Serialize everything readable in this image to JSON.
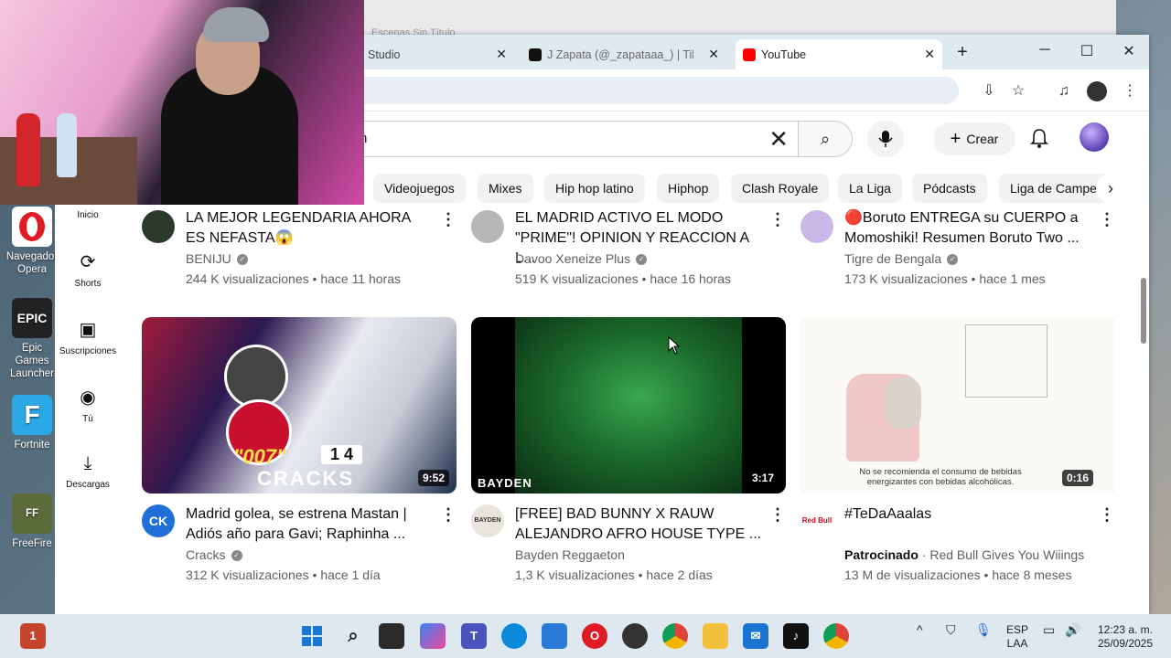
{
  "desktop": {
    "icons": [
      {
        "label": "Navegador Opera",
        "icon": "opera-icon",
        "color": "#e11b26"
      },
      {
        "label": "Epic Games Launcher",
        "icon": "epic-games-icon",
        "color": "#222222"
      },
      {
        "label": "Fortnite",
        "icon": "fortnite-icon",
        "color": "#2aa9e6"
      },
      {
        "label": "FreeFire",
        "icon": "freefire-icon",
        "color": "#5c6b3a"
      }
    ],
    "back_window_title": "Escenas Sin Título"
  },
  "browser": {
    "tabs": [
      {
        "label": "Studio"
      },
      {
        "label": "J Zapata (@_zapataaa_) | TikTok"
      },
      {
        "label": "YouTube",
        "active": true
      }
    ],
    "window_controls": {
      "minimize": "─",
      "maximize": "☐",
      "close": "✕"
    },
    "new_tab": "+"
  },
  "youtube": {
    "search_value": "h",
    "create_label": "Crear",
    "chips": [
      "Videojuegos",
      "Mixes",
      "Hip hop latino",
      "Hiphop",
      "Clash Royale",
      "La Liga",
      "Pódcasts",
      "Liga de Campeo"
    ],
    "sidebar": [
      {
        "label": "Inicio",
        "icon": "home-icon"
      },
      {
        "label": "Shorts",
        "icon": "shorts-icon"
      },
      {
        "label": "Suscripciones",
        "icon": "subscriptions-icon"
      },
      {
        "label": "Tú",
        "icon": "you-icon"
      },
      {
        "label": "Descargas",
        "icon": "downloads-icon"
      }
    ],
    "row1": [
      {
        "title": "LA MEJOR LEGENDARIA AHORA ES NEFASTA😱",
        "channel": "BENIJU",
        "meta": "244 K visualizaciones • hace 11 horas"
      },
      {
        "title": "EL MADRID ACTIVO EL MODO \"PRIME\"! OPINION Y REACCION A L...",
        "channel": "Davoo Xeneize Plus",
        "meta": "519 K visualizaciones • hace 16 horas"
      },
      {
        "title": "🔴Boruto ENTREGA su CUERPO a Momoshiki! Resumen Boruto Two ...",
        "channel": "Tigre de Bengala",
        "meta": "173 K visualizaciones • hace 1 mes"
      }
    ],
    "row2": [
      {
        "title": "Madrid golea, se estrena Mastan | Adiós año para Gavi; Raphinha ...",
        "channel": "Cracks",
        "meta": "312 K visualizaciones • hace 1 día",
        "duration": "9:52",
        "thumb_text": "CRACKS",
        "score": "1 4",
        "badge": "\"007\"",
        "avatar_text": "CK"
      },
      {
        "title": "[FREE] BAD BUNNY X RAUW ALEJANDRO AFRO HOUSE TYPE ...",
        "channel": "Bayden Reggaeton",
        "meta": "1,3 K visualizaciones • hace 2 días",
        "duration": "3:17",
        "thumb_text": "BAYDEN",
        "avatar_text": "BAYDEN"
      },
      {
        "title": "#TeDaAaalas",
        "sponsored": "Patrocinado",
        "channel": "Red Bull Gives You Wiiings",
        "meta": "13 M de visualizaciones • hace 8 meses",
        "duration": "0:16",
        "thumb_caption": "No se recomienda el consumo de bebidas energizantes con bebidas alcohólicas.",
        "avatar_text": "Red Bull"
      }
    ]
  },
  "taskbar": {
    "language": "ESP",
    "language_sub": "LAA",
    "time": "12:23 a. m.",
    "date": "25/09/2025"
  }
}
